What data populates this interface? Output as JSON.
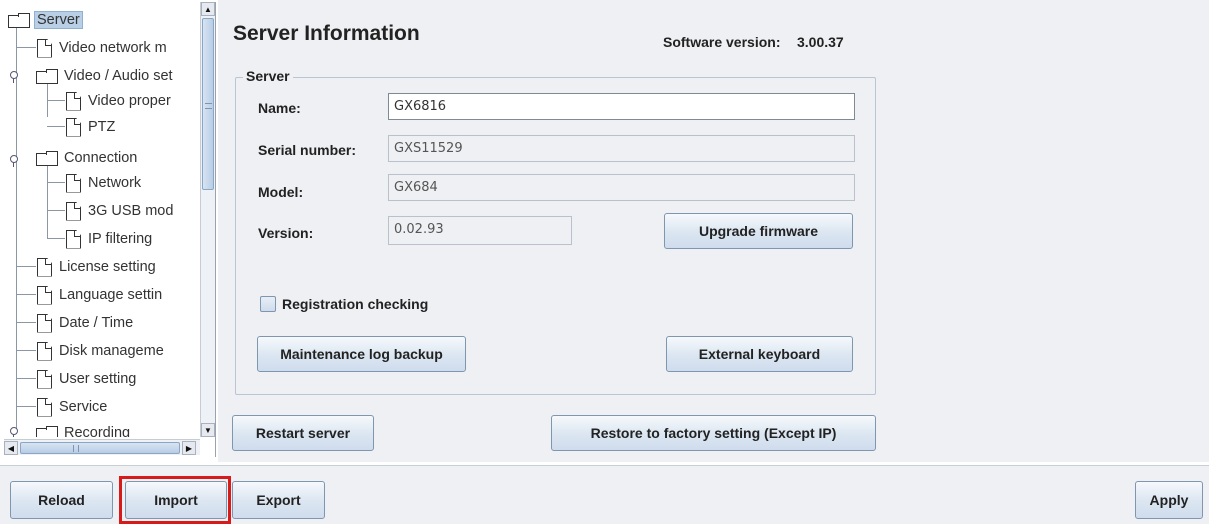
{
  "tree": {
    "items": [
      {
        "label": "Server",
        "type": "folder",
        "selected": true
      },
      {
        "label": "Video network m",
        "type": "doc"
      },
      {
        "label": "Video / Audio set",
        "type": "folder"
      },
      {
        "label": "Video proper",
        "type": "doc"
      },
      {
        "label": "PTZ",
        "type": "doc"
      },
      {
        "label": "Connection",
        "type": "folder"
      },
      {
        "label": "Network",
        "type": "doc"
      },
      {
        "label": "3G USB mod",
        "type": "doc"
      },
      {
        "label": "IP filtering",
        "type": "doc"
      },
      {
        "label": "License setting",
        "type": "doc"
      },
      {
        "label": "Language settin",
        "type": "doc"
      },
      {
        "label": "Date / Time",
        "type": "doc"
      },
      {
        "label": "Disk manageme",
        "type": "doc"
      },
      {
        "label": "User setting",
        "type": "doc"
      },
      {
        "label": "Service",
        "type": "doc"
      },
      {
        "label": "Recording",
        "type": "folder"
      }
    ]
  },
  "main": {
    "title": "Server Information",
    "software_version_label": "Software version:",
    "software_version_value": "3.00.37",
    "group_title": "Server",
    "fields": {
      "name": {
        "label": "Name:",
        "value": "GX6816"
      },
      "serial": {
        "label": "Serial number:",
        "value": "GXS11529"
      },
      "model": {
        "label": "Model:",
        "value": "GX684"
      },
      "version": {
        "label": "Version:",
        "value": "0.02.93"
      }
    },
    "upgrade_button": "Upgrade firmware",
    "registration_checkbox": {
      "label": "Registration checking",
      "checked": false
    },
    "maintenance_button": "Maintenance log backup",
    "external_keyboard_button": "External keyboard",
    "restart_button": "Restart server",
    "restore_button": "Restore to factory setting (Except IP)"
  },
  "bottom": {
    "reload": "Reload",
    "import": "Import",
    "export": "Export",
    "apply": "Apply"
  },
  "colors": {
    "highlight": "#d71a1a",
    "panel_bg": "#eef0f3",
    "button_border": "#7f96af"
  }
}
